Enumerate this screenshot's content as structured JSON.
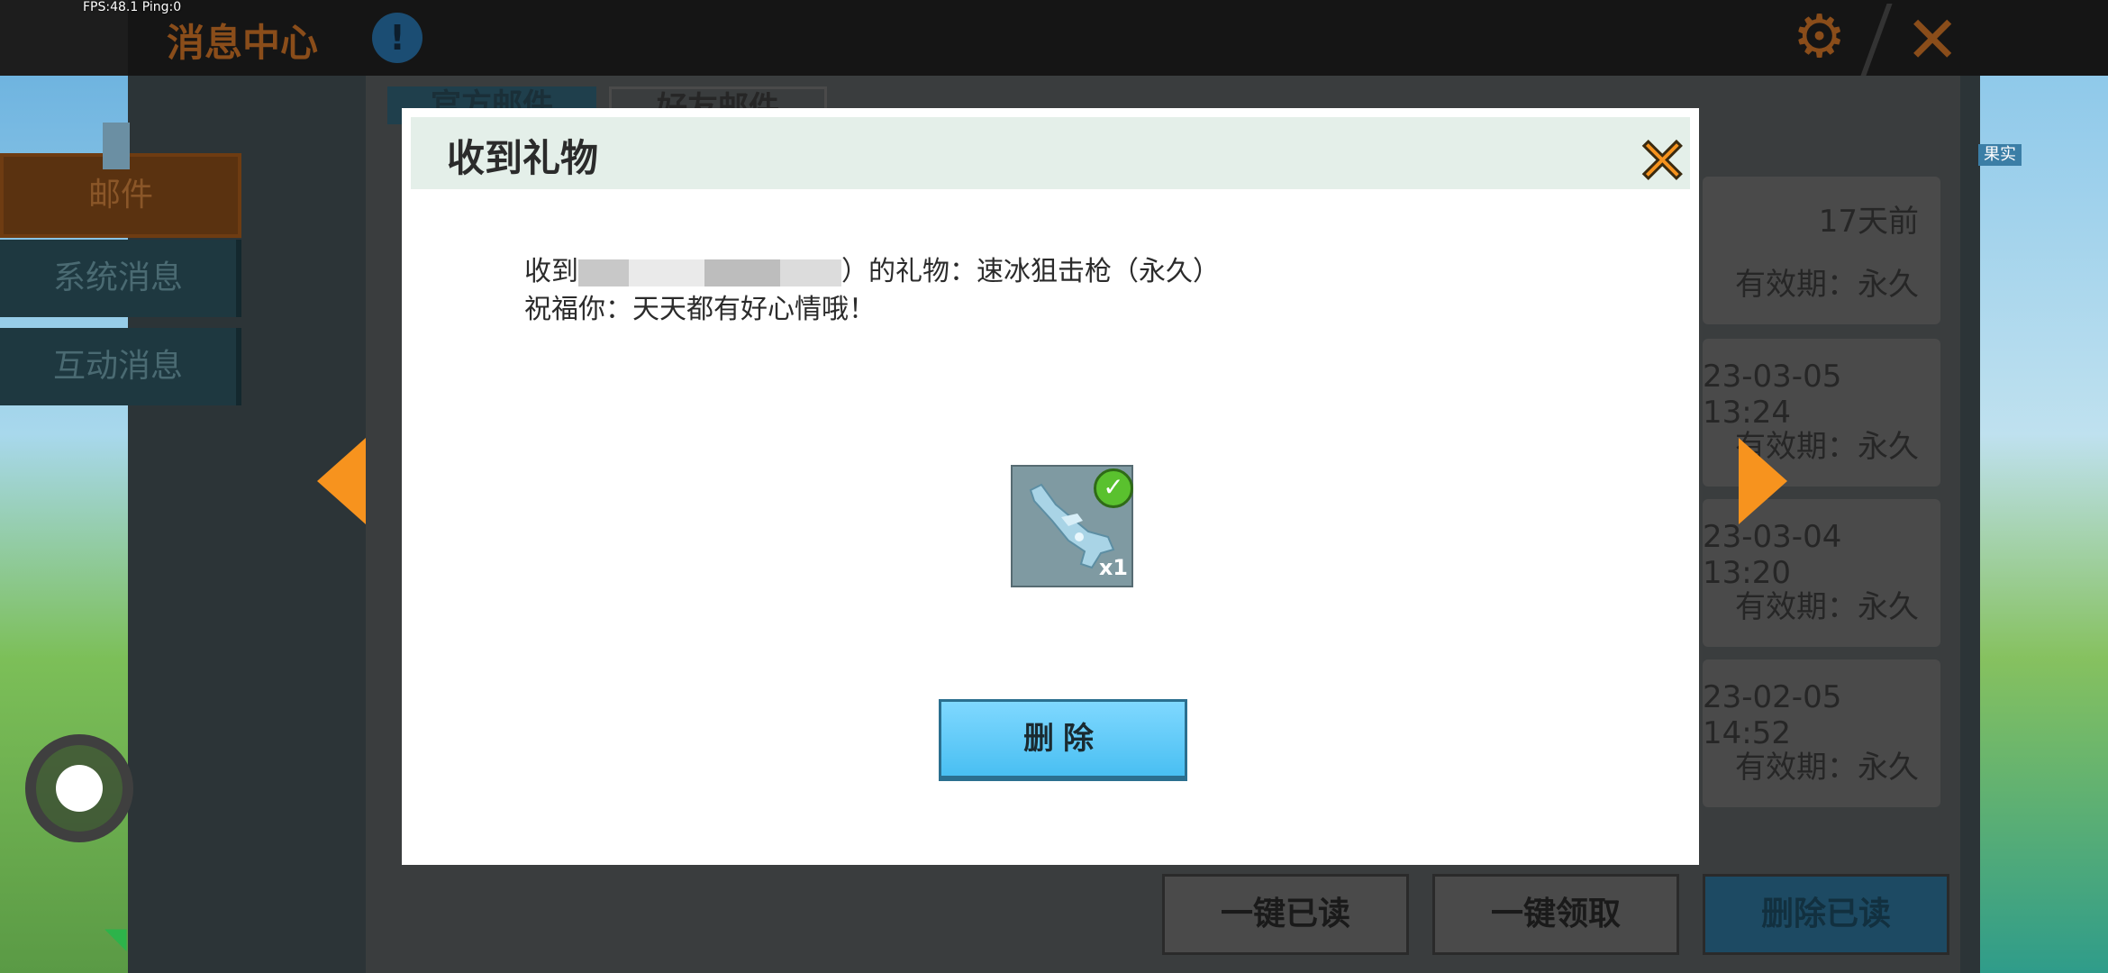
{
  "hud": {
    "fps": "FPS:48.1  Ping:0"
  },
  "header": {
    "title": "消息中心",
    "info_icon": "!"
  },
  "sidebar": {
    "items": [
      {
        "label": "邮件",
        "active": true
      },
      {
        "label": "系统消息",
        "active": false
      },
      {
        "label": "互动消息",
        "active": false
      }
    ]
  },
  "tabs": [
    {
      "label": "官方邮件"
    },
    {
      "label": "好友邮件"
    }
  ],
  "mail_list": [
    {
      "time": "17天前",
      "valid": "有效期：永久"
    },
    {
      "time": "23-03-05 13:24",
      "valid": "有效期：永久"
    },
    {
      "time": "23-03-04 13:20",
      "valid": "有效期：永久"
    },
    {
      "time": "23-02-05 14:52",
      "valid": "有效期：永久"
    }
  ],
  "bottom_actions": {
    "read_all": "一键已读",
    "claim_all": "一键领取",
    "delete_read": "删除已读"
  },
  "right_label": "果实",
  "modal": {
    "title": "收到礼物",
    "message_prefix": "收到",
    "message_suffix": "）的礼物：速冰狙击枪（永久）",
    "message_line2": "祝福你：天天都有好心情哦！",
    "item": {
      "quantity": "x1",
      "claimed": true
    },
    "delete_label": "删除"
  },
  "colors": {
    "accent": "#f7931e",
    "button_blue": "#49bff2",
    "header_brown": "#8a4d1a"
  }
}
